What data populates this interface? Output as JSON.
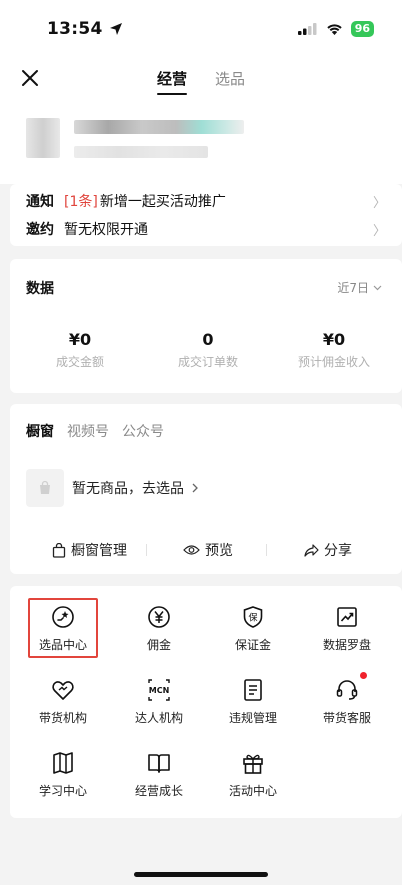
{
  "status_bar": {
    "time": "13:54",
    "battery": "96"
  },
  "nav": {
    "tabs": [
      {
        "label": "经营",
        "active": true
      },
      {
        "label": "选品",
        "active": false
      }
    ]
  },
  "notices": [
    {
      "key": "通知",
      "tag": "[1条]",
      "text": "新增一起买活动推广"
    },
    {
      "key": "邀约",
      "tag": "",
      "text": "暂无权限开通"
    }
  ],
  "data_section": {
    "title": "数据",
    "range": "近7日",
    "metrics": [
      {
        "value": "¥0",
        "label": "成交金额"
      },
      {
        "value": "0",
        "label": "成交订单数"
      },
      {
        "value": "¥0",
        "label": "预计佣金收入"
      }
    ]
  },
  "window": {
    "tabs": [
      {
        "label": "橱窗",
        "active": true
      },
      {
        "label": "视频号",
        "active": false
      },
      {
        "label": "公众号",
        "active": false
      }
    ],
    "empty_text": "暂无商品，去选品",
    "actions": [
      {
        "label": "橱窗管理",
        "icon": "bag-icon"
      },
      {
        "label": "预览",
        "icon": "eye-icon"
      },
      {
        "label": "分享",
        "icon": "share-icon"
      }
    ]
  },
  "tools": [
    {
      "label": "选品中心",
      "icon": "product-center-icon",
      "highlighted": true
    },
    {
      "label": "佣金",
      "icon": "yen-icon"
    },
    {
      "label": "保证金",
      "icon": "shield-guarantee-icon"
    },
    {
      "label": "数据罗盘",
      "icon": "chart-trend-icon"
    },
    {
      "label": "带货机构",
      "icon": "agency-icon"
    },
    {
      "label": "达人机构",
      "icon": "mcn-icon"
    },
    {
      "label": "违规管理",
      "icon": "document-icon"
    },
    {
      "label": "带货客服",
      "icon": "headset-icon",
      "badge": true
    },
    {
      "label": "学习中心",
      "icon": "open-book-icon"
    },
    {
      "label": "经营成长",
      "icon": "book-icon"
    },
    {
      "label": "活动中心",
      "icon": "gift-icon"
    }
  ],
  "colors": {
    "accent_red": "#e2453c",
    "battery_green": "#35c759"
  }
}
